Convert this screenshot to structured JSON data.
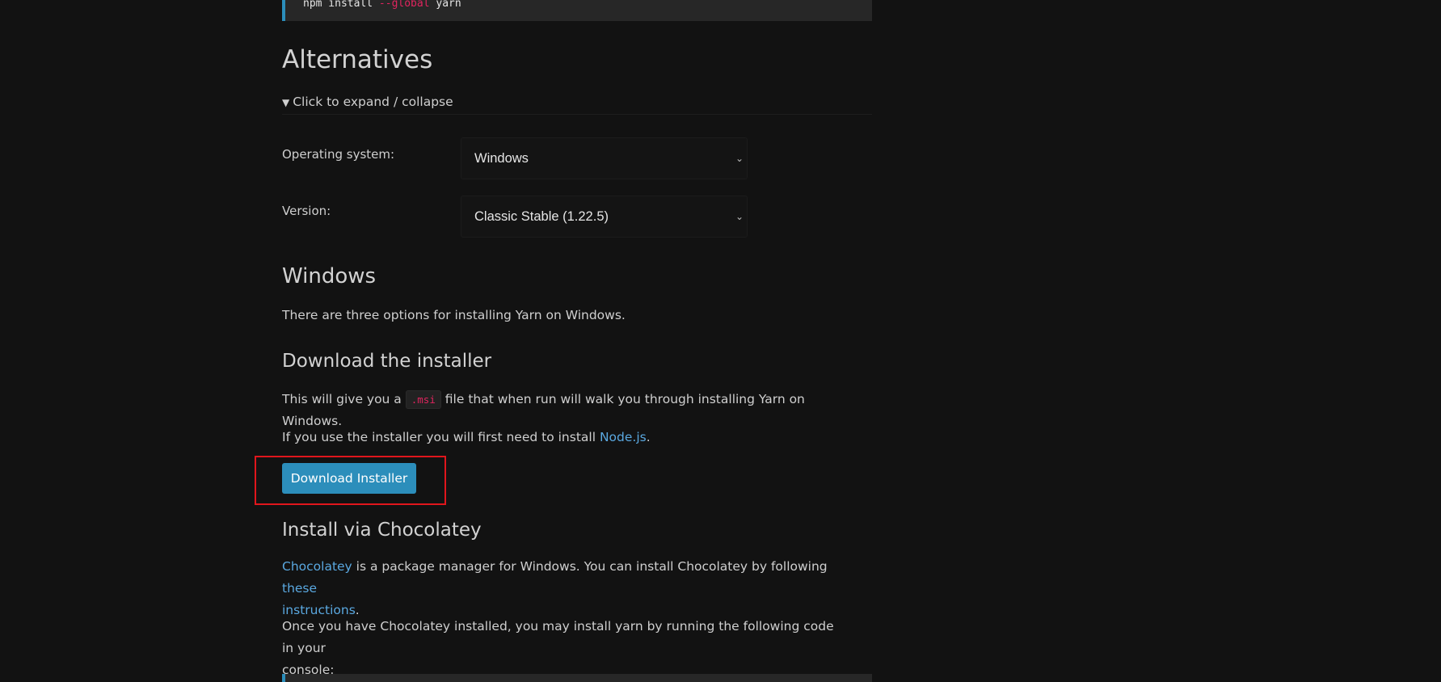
{
  "colors": {
    "accent": "#2c8ebb",
    "code_flag": "#e0245e",
    "link": "#5aa8e0",
    "highlight": "#e0161c"
  },
  "top_code": {
    "cmd": "npm install ",
    "flag": "--global",
    "arg": " yarn"
  },
  "alternatives": {
    "title": "Alternatives",
    "expander_icon": "triangle-down-icon",
    "expander_label": "Click to expand / collapse"
  },
  "os_select": {
    "label": "Operating system:",
    "value": "Windows",
    "icon": "chevron-down-icon"
  },
  "version_select": {
    "label": "Version:",
    "value": "Classic Stable (1.22.5)",
    "icon": "chevron-down-icon"
  },
  "windows": {
    "title": "Windows",
    "intro": "There are three options for installing Yarn on Windows."
  },
  "installer": {
    "title": "Download the installer",
    "p1_before": "This will give you a ",
    "p1_code": ".msi",
    "p1_after": " file that when run will walk you through installing Yarn on Windows.",
    "p2_before": "If you use the installer you will first need to install ",
    "p2_link": "Node.js",
    "p2_after": ".",
    "button_label": "Download Installer"
  },
  "chocolatey": {
    "title": "Install via Chocolatey",
    "p1_link1": "Chocolatey",
    "p1_mid": " is a package manager for Windows. You can install Chocolatey by following ",
    "p1_link2a": "these",
    "p1_link2b": "instructions",
    "p1_end": ".",
    "p2_line1": "Once you have Chocolatey installed, you may install yarn by running the following code in your",
    "p2_line2": "console:"
  }
}
